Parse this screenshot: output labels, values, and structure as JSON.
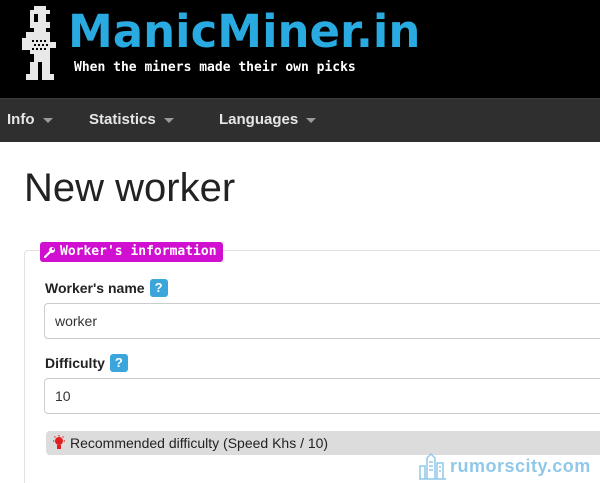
{
  "header": {
    "site_title": "ManicMiner.in",
    "tagline": "When the miners made their own picks",
    "logo_icon": "miner-pixel-icon",
    "accent_color": "#29abe2"
  },
  "nav": {
    "items": [
      {
        "label": "Info"
      },
      {
        "label": "Statistics"
      },
      {
        "label": "Languages"
      }
    ],
    "caret_icon": "caret-down-icon"
  },
  "page": {
    "title": "New worker"
  },
  "form": {
    "legend": "Worker's information",
    "legend_icon": "wrench-icon",
    "legend_color": "#d10fd0",
    "worker_name": {
      "label": "Worker's name",
      "help": "?",
      "value": "worker"
    },
    "difficulty": {
      "label": "Difficulty",
      "help": "?",
      "value": "10"
    },
    "recommendation": {
      "icon": "lightbulb-icon",
      "text": "Recommended difficulty (Speed Khs / 10)"
    }
  },
  "watermark": {
    "text": "rumorscity.com",
    "icon": "city-skyline-icon"
  }
}
